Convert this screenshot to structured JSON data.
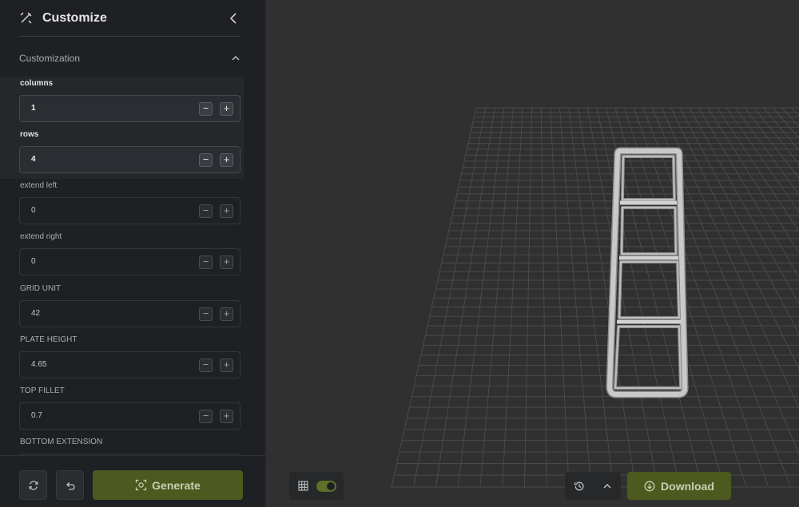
{
  "header": {
    "title": "Customize"
  },
  "section": {
    "label": "Customization"
  },
  "fields": [
    {
      "label": "columns",
      "value": "1"
    },
    {
      "label": "rows",
      "value": "4"
    },
    {
      "label": "extend left",
      "value": "0"
    },
    {
      "label": "extend right",
      "value": "0"
    },
    {
      "label": "GRID UNIT",
      "value": "42"
    },
    {
      "label": "PLATE HEIGHT",
      "value": "4.65"
    },
    {
      "label": "TOP FILLET",
      "value": "0.7"
    },
    {
      "label": "BOTTOM EXTENSION",
      "value": ""
    }
  ],
  "stepper": {
    "minus": "−",
    "plus": "+"
  },
  "footer": {
    "generate_label": "Generate"
  },
  "viewport": {
    "download_label": "Download",
    "grid_toggle_on": true
  },
  "colors": {
    "accent": "#4c5a1f",
    "accent_text": "#c8cfb3",
    "sidebar_bg": "#1e2023",
    "viewport_bg": "#303030"
  },
  "icons": [
    "wand-icon",
    "chevron-left-icon",
    "chevron-up-icon",
    "refresh-icon",
    "undo-icon",
    "generate-icon",
    "grid-icon",
    "history-icon",
    "download-icon"
  ]
}
